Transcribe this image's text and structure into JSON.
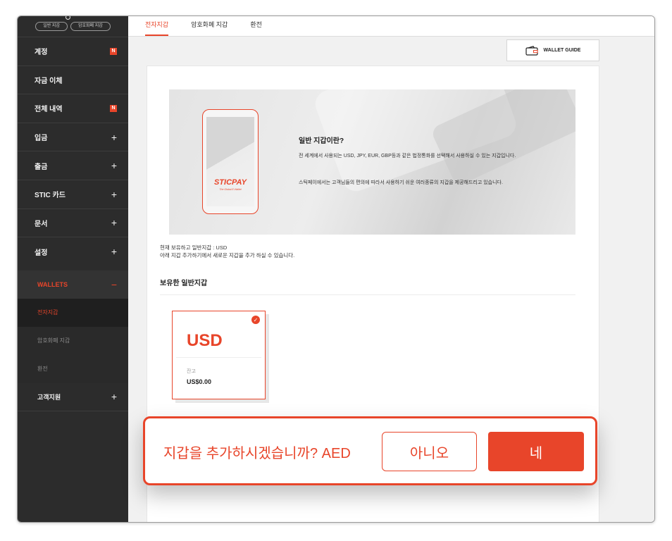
{
  "sidebar": {
    "pills": [
      "일반 지갑",
      "암호화폐 지갑"
    ],
    "items": [
      {
        "label": "계정",
        "badge": "N"
      },
      {
        "label": "자금 이체"
      },
      {
        "label": "전체 내역",
        "badge": "N"
      },
      {
        "label": "입금",
        "expand": "+"
      },
      {
        "label": "출금",
        "expand": "+"
      },
      {
        "label": "STIC 카드",
        "expand": "+"
      },
      {
        "label": "문서",
        "expand": "+"
      },
      {
        "label": "설정",
        "expand": "+"
      }
    ],
    "wallets": {
      "label": "WALLETS",
      "collapse": "−"
    },
    "sub_items": [
      "전자지갑",
      "암호화폐 지갑",
      "환전"
    ],
    "support": {
      "label": "고객지원",
      "expand": "+"
    }
  },
  "tabs": [
    "전자지갑",
    "암호화폐 지갑",
    "환전"
  ],
  "guide_button": {
    "label": "WALLET GUIDE",
    "icon": "wallet-icon"
  },
  "hero": {
    "brand": "STICPAY",
    "tagline": "The Global E-Wallet",
    "title": "일반 지갑이란?",
    "p1": "전 세계에서 사용되는 USD, JPY, EUR, GBP등과 같은 법정통화를 선택해서 사용하실 수 있는 지갑입니다.",
    "p2": "스틱페이에서는 고객님들의 편의에 따라서 사용하기 쉬운 여러종류의 지갑을 제공해드리고 있습니다."
  },
  "info": {
    "line1": "현재 보유하고 일반지갑 : USD",
    "line2": "아래 지갑 추가하기에서 새로운 지갑을 추가 하실 수 있습니다."
  },
  "section_title": "보유한 일반지갑",
  "card": {
    "code": "USD",
    "label": "잔고",
    "amount": "US$0.00"
  },
  "confirm": {
    "text": "지갑을 추가하시겠습니까? AED",
    "no": "아니오",
    "yes": "네"
  },
  "colors": {
    "accent": "#e8452a",
    "sidebar": "#2c2c2c"
  }
}
